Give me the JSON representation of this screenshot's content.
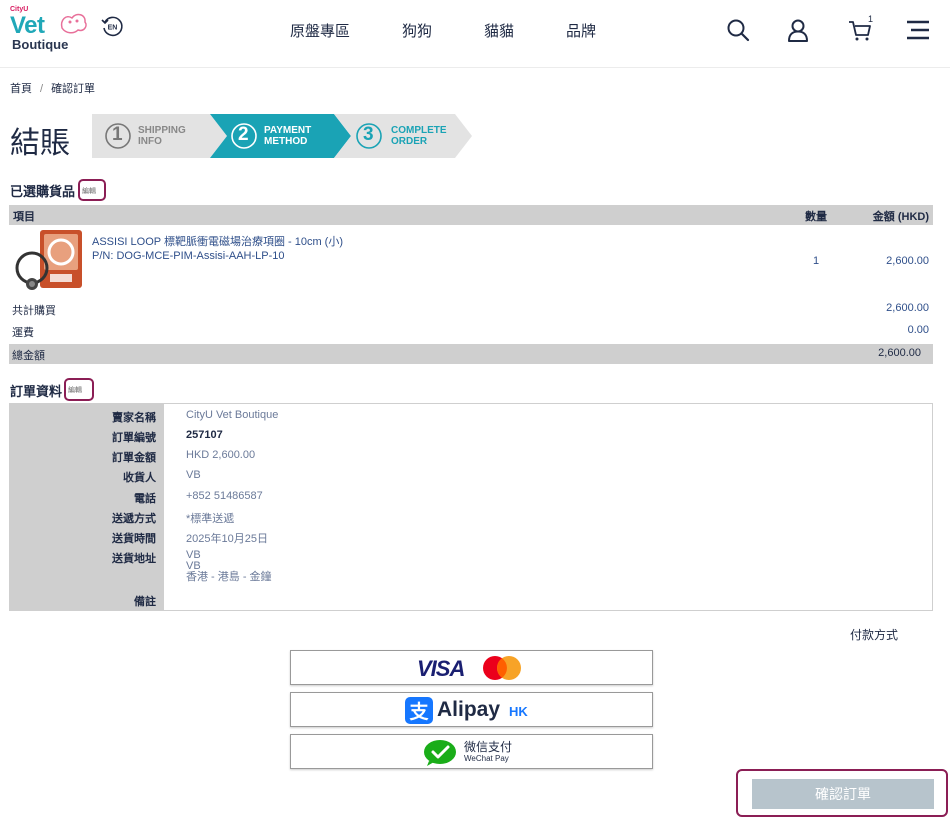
{
  "header": {
    "logo_cityu": "CityU",
    "logo_vet": "Vet",
    "logo_boutique": "Boutique",
    "lang_label": "EN",
    "nav": [
      "原盤專區",
      "狗狗",
      "貓貓",
      "品牌"
    ],
    "cart_count": "1"
  },
  "breadcrumb": {
    "home": "首頁",
    "separator": "/",
    "current": "確認訂單"
  },
  "page_title": "結賬",
  "steps": [
    {
      "num": "1",
      "line1": "SHIPPING",
      "line2": "INFO",
      "active": false
    },
    {
      "num": "2",
      "line1": "PAYMENT",
      "line2": "METHOD",
      "active": true
    },
    {
      "num": "3",
      "line1": "COMPLETE",
      "line2": "ORDER",
      "active": false
    }
  ],
  "items_section": {
    "heading": "已選購貨品",
    "edit": "編輯",
    "col_item": "項目",
    "col_qty": "數量",
    "col_amount": "金額 (HKD)",
    "product_name": "ASSISI LOOP 標靶脈衝電磁場治療項圈 - 10cm (小)",
    "product_pn": "P/N: DOG-MCE-PIM-Assisi-AAH-LP-10",
    "product_qty": "1",
    "product_amount": "2,600.00",
    "subtotal_label": "共計購買",
    "subtotal_value": "2,600.00",
    "shipping_label": "運費",
    "shipping_value": "0.00",
    "total_label": "總金額",
    "total_value": "2,600.00"
  },
  "order_section": {
    "heading": "訂單資料",
    "edit": "編輯",
    "rows": [
      {
        "label": "賣家名稱",
        "value": "CityU Vet Boutique"
      },
      {
        "label": "訂單編號",
        "value": "257107"
      },
      {
        "label": "訂單金額",
        "value": "HKD 2,600.00"
      },
      {
        "label": "收貨人",
        "value": "VB"
      },
      {
        "label": "電話",
        "value": "+852 51486587"
      },
      {
        "label": "送遞方式",
        "value": "*標準送遞"
      },
      {
        "label": "送貨時間",
        "value": "2025年10月25日"
      },
      {
        "label": "送貨地址",
        "value_lines": [
          "VB",
          "VB",
          "香港 - 港島 - 金鐘"
        ]
      },
      {
        "label": "備註",
        "value": ""
      }
    ]
  },
  "payment": {
    "label": "付款方式",
    "visa": "VISA",
    "alipay": "Alipay",
    "alipay_suffix": "HK",
    "wechat_cn": "微信支付",
    "wechat_en": "WeChat Pay"
  },
  "confirm_button": "確認訂單",
  "colors": {
    "teal": "#1aa3b5",
    "navy": "#1f2a44",
    "highlight": "#8b1e55",
    "table_gray": "#cfcfcf",
    "confirm_disabled": "#b7c4cc",
    "visa_blue": "#1a1f71",
    "mc_red": "#eb001b",
    "mc_orange": "#f79e1b",
    "alipay_blue": "#1677ff",
    "wechat_green": "#1aad19"
  }
}
